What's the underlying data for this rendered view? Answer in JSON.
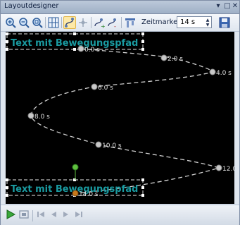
{
  "window": {
    "title": "Layoutdesigner"
  },
  "toolbar": {
    "zeitmarke_label": "Zeitmarke:",
    "zeitmarke_value": "14 s"
  },
  "canvas": {
    "text_item_label": "Text mit Bewegungspfad",
    "timestamps": [
      "0.0 s",
      "2.0 s",
      "4.0 s",
      "6.0 s",
      "8.0 s",
      "10.0 s",
      "12.0",
      "14.0 s"
    ]
  },
  "colors": {
    "canvas_bg": "#000000",
    "text_teal": "#1a9aa0",
    "path_dash": "#d0d0d0",
    "rotate_handle": "#5fbf3f",
    "current_point": "#c8781a"
  }
}
